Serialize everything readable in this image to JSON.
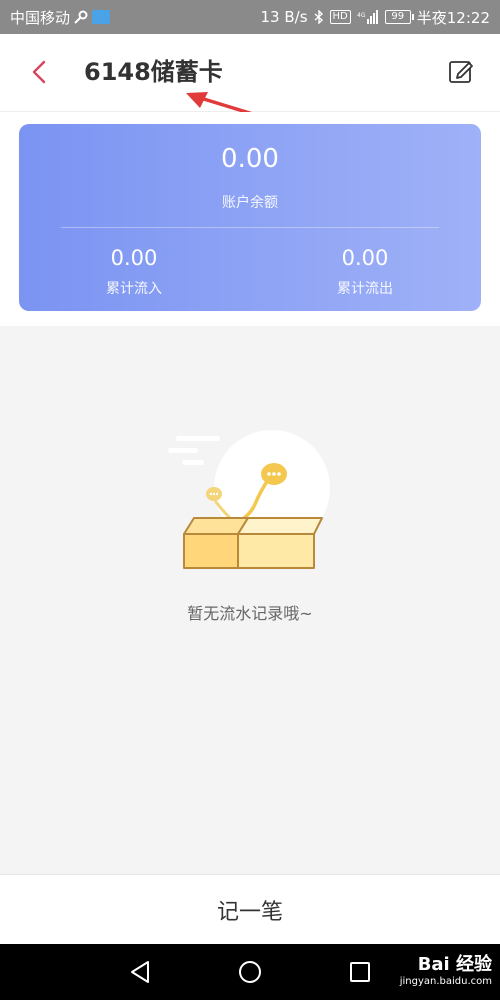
{
  "status_bar": {
    "carrier": "中国移动",
    "speed": "13 B/s",
    "battery": "99",
    "time": "半夜12:22",
    "icons": [
      "key-icon",
      "app-icon",
      "bluetooth-icon",
      "hd-icon",
      "signal-icon",
      "battery-icon"
    ]
  },
  "header": {
    "title": "6148储蓄卡",
    "back_icon": "chevron-left-icon",
    "edit_icon": "edit-icon"
  },
  "summary": {
    "balance_value": "0.00",
    "balance_label": "账户余额",
    "inflow_value": "0.00",
    "inflow_label": "累计流入",
    "outflow_value": "0.00",
    "outflow_label": "累计流出"
  },
  "empty_state": {
    "illustration": "empty-box-illustration",
    "text": "暂无流水记录哦~"
  },
  "bottom": {
    "record_label": "记一笔"
  },
  "watermark": {
    "main": "Bai 经验",
    "sub": "jingyan.baidu.com"
  },
  "colors": {
    "card_gradient_start": "#7b94f2",
    "card_gradient_end": "#9fb1f7",
    "back_icon": "#d9455f",
    "annotation_arrow": "#e03a3a"
  }
}
